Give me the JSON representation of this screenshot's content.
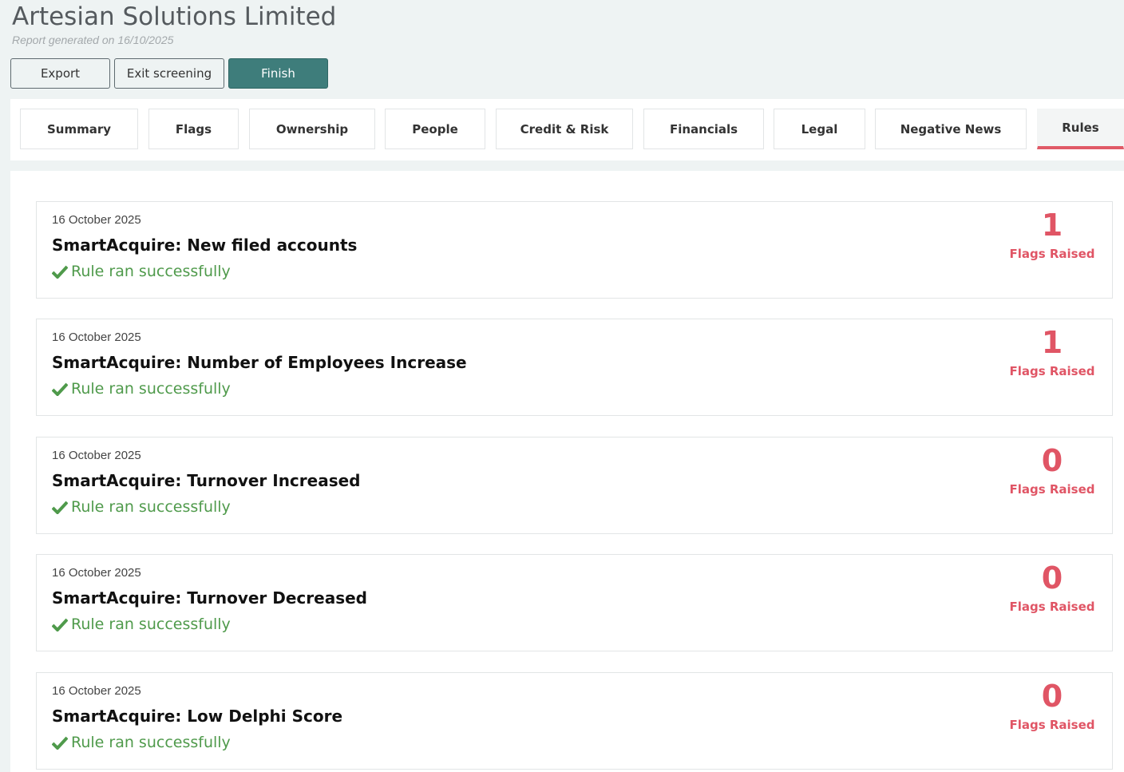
{
  "header": {
    "company_name": "Artesian Solutions Limited",
    "report_date": "Report generated on 16/10/2025",
    "buttons": {
      "export": "Export",
      "exit": "Exit screening",
      "finish": "Finish"
    }
  },
  "tabs": [
    {
      "label": "Summary"
    },
    {
      "label": "Flags"
    },
    {
      "label": "Ownership"
    },
    {
      "label": "People"
    },
    {
      "label": "Credit & Risk"
    },
    {
      "label": "Financials"
    },
    {
      "label": "Legal"
    },
    {
      "label": "Negative News"
    },
    {
      "label": "Rules",
      "active": true
    }
  ],
  "rules": [
    {
      "date": "16 October 2025",
      "name": "SmartAcquire: New filed accounts",
      "status": "Rule ran successfully",
      "flags": "1",
      "flags_label": "Flags Raised"
    },
    {
      "date": "16 October 2025",
      "name": "SmartAcquire: Number of Employees Increase",
      "status": "Rule ran successfully",
      "flags": "1",
      "flags_label": "Flags Raised"
    },
    {
      "date": "16 October 2025",
      "name": "SmartAcquire: Turnover Increased",
      "status": "Rule ran successfully",
      "flags": "0",
      "flags_label": "Flags Raised"
    },
    {
      "date": "16 October 2025",
      "name": "SmartAcquire: Turnover Decreased",
      "status": "Rule ran successfully",
      "flags": "0",
      "flags_label": "Flags Raised"
    },
    {
      "date": "16 October 2025",
      "name": "SmartAcquire: Low Delphi Score",
      "status": "Rule ran successfully",
      "flags": "0",
      "flags_label": "Flags Raised"
    }
  ],
  "colors": {
    "accent_teal": "#3e7d7b",
    "flag_red": "#e05565",
    "success_green": "#4f9a4b",
    "active_tab_underline": "#e05a67"
  },
  "icons": {
    "status": "check-icon"
  }
}
